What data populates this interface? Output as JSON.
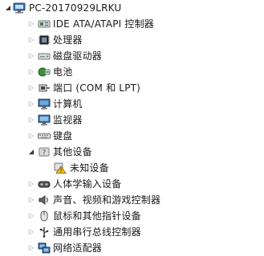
{
  "root": {
    "label": "PC-20170929LRKU",
    "icon": "computer-icon",
    "expander": "collapse-arrow"
  },
  "categories": [
    {
      "key": "ide",
      "label": "IDE ATA/ATAPI 控制器",
      "icon": "controller-icon"
    },
    {
      "key": "cpu",
      "label": "处理器",
      "icon": "processor-icon"
    },
    {
      "key": "disk",
      "label": "磁盘驱动器",
      "icon": "disk-drive-icon"
    },
    {
      "key": "battery",
      "label": "电池",
      "icon": "battery-icon"
    },
    {
      "key": "ports",
      "label": "端口 (COM 和 LPT)",
      "icon": "port-icon"
    },
    {
      "key": "computer",
      "label": "计算机",
      "icon": "monitor-icon"
    },
    {
      "key": "monitor",
      "label": "监视器",
      "icon": "monitor-icon"
    },
    {
      "key": "keyboard",
      "label": "键盘",
      "icon": "keyboard-icon"
    },
    {
      "key": "other",
      "label": "其他设备",
      "icon": "unknown-device-icon",
      "expanded": true
    },
    {
      "key": "unknown",
      "label": "未知设备",
      "icon": "warning-device-icon",
      "child": true
    },
    {
      "key": "hid",
      "label": "人体学输入设备",
      "icon": "hid-icon"
    },
    {
      "key": "sound",
      "label": "声音、视频和游戏控制器",
      "icon": "speaker-icon"
    },
    {
      "key": "mouse",
      "label": "鼠标和其他指针设备",
      "icon": "mouse-icon"
    },
    {
      "key": "usb",
      "label": "通用串行总线控制器",
      "icon": "usb-icon"
    },
    {
      "key": "net",
      "label": "网络适配器",
      "icon": "network-icon"
    }
  ]
}
